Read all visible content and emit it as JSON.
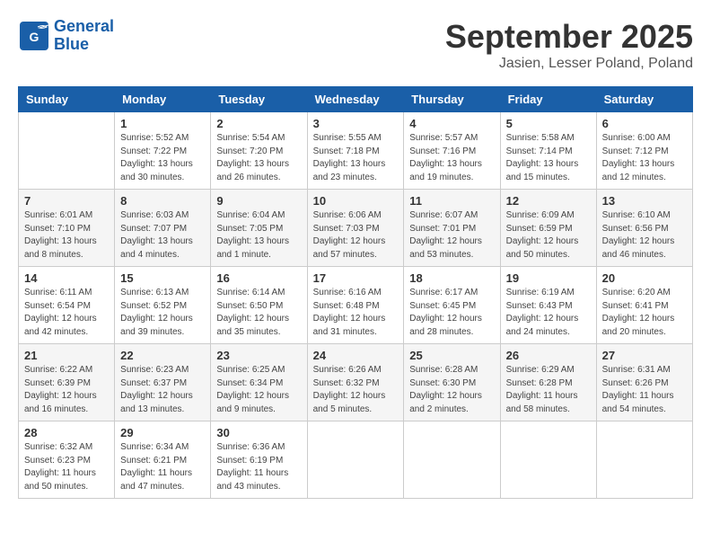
{
  "header": {
    "logo_line1": "General",
    "logo_line2": "Blue",
    "main_title": "September 2025",
    "subtitle": "Jasien, Lesser Poland, Poland"
  },
  "weekdays": [
    "Sunday",
    "Monday",
    "Tuesday",
    "Wednesday",
    "Thursday",
    "Friday",
    "Saturday"
  ],
  "weeks": [
    [
      {
        "day": "",
        "sunrise": "",
        "sunset": "",
        "daylight": ""
      },
      {
        "day": "1",
        "sunrise": "Sunrise: 5:52 AM",
        "sunset": "Sunset: 7:22 PM",
        "daylight": "Daylight: 13 hours and 30 minutes."
      },
      {
        "day": "2",
        "sunrise": "Sunrise: 5:54 AM",
        "sunset": "Sunset: 7:20 PM",
        "daylight": "Daylight: 13 hours and 26 minutes."
      },
      {
        "day": "3",
        "sunrise": "Sunrise: 5:55 AM",
        "sunset": "Sunset: 7:18 PM",
        "daylight": "Daylight: 13 hours and 23 minutes."
      },
      {
        "day": "4",
        "sunrise": "Sunrise: 5:57 AM",
        "sunset": "Sunset: 7:16 PM",
        "daylight": "Daylight: 13 hours and 19 minutes."
      },
      {
        "day": "5",
        "sunrise": "Sunrise: 5:58 AM",
        "sunset": "Sunset: 7:14 PM",
        "daylight": "Daylight: 13 hours and 15 minutes."
      },
      {
        "day": "6",
        "sunrise": "Sunrise: 6:00 AM",
        "sunset": "Sunset: 7:12 PM",
        "daylight": "Daylight: 13 hours and 12 minutes."
      }
    ],
    [
      {
        "day": "7",
        "sunrise": "Sunrise: 6:01 AM",
        "sunset": "Sunset: 7:10 PM",
        "daylight": "Daylight: 13 hours and 8 minutes."
      },
      {
        "day": "8",
        "sunrise": "Sunrise: 6:03 AM",
        "sunset": "Sunset: 7:07 PM",
        "daylight": "Daylight: 13 hours and 4 minutes."
      },
      {
        "day": "9",
        "sunrise": "Sunrise: 6:04 AM",
        "sunset": "Sunset: 7:05 PM",
        "daylight": "Daylight: 13 hours and 1 minute."
      },
      {
        "day": "10",
        "sunrise": "Sunrise: 6:06 AM",
        "sunset": "Sunset: 7:03 PM",
        "daylight": "Daylight: 12 hours and 57 minutes."
      },
      {
        "day": "11",
        "sunrise": "Sunrise: 6:07 AM",
        "sunset": "Sunset: 7:01 PM",
        "daylight": "Daylight: 12 hours and 53 minutes."
      },
      {
        "day": "12",
        "sunrise": "Sunrise: 6:09 AM",
        "sunset": "Sunset: 6:59 PM",
        "daylight": "Daylight: 12 hours and 50 minutes."
      },
      {
        "day": "13",
        "sunrise": "Sunrise: 6:10 AM",
        "sunset": "Sunset: 6:56 PM",
        "daylight": "Daylight: 12 hours and 46 minutes."
      }
    ],
    [
      {
        "day": "14",
        "sunrise": "Sunrise: 6:11 AM",
        "sunset": "Sunset: 6:54 PM",
        "daylight": "Daylight: 12 hours and 42 minutes."
      },
      {
        "day": "15",
        "sunrise": "Sunrise: 6:13 AM",
        "sunset": "Sunset: 6:52 PM",
        "daylight": "Daylight: 12 hours and 39 minutes."
      },
      {
        "day": "16",
        "sunrise": "Sunrise: 6:14 AM",
        "sunset": "Sunset: 6:50 PM",
        "daylight": "Daylight: 12 hours and 35 minutes."
      },
      {
        "day": "17",
        "sunrise": "Sunrise: 6:16 AM",
        "sunset": "Sunset: 6:48 PM",
        "daylight": "Daylight: 12 hours and 31 minutes."
      },
      {
        "day": "18",
        "sunrise": "Sunrise: 6:17 AM",
        "sunset": "Sunset: 6:45 PM",
        "daylight": "Daylight: 12 hours and 28 minutes."
      },
      {
        "day": "19",
        "sunrise": "Sunrise: 6:19 AM",
        "sunset": "Sunset: 6:43 PM",
        "daylight": "Daylight: 12 hours and 24 minutes."
      },
      {
        "day": "20",
        "sunrise": "Sunrise: 6:20 AM",
        "sunset": "Sunset: 6:41 PM",
        "daylight": "Daylight: 12 hours and 20 minutes."
      }
    ],
    [
      {
        "day": "21",
        "sunrise": "Sunrise: 6:22 AM",
        "sunset": "Sunset: 6:39 PM",
        "daylight": "Daylight: 12 hours and 16 minutes."
      },
      {
        "day": "22",
        "sunrise": "Sunrise: 6:23 AM",
        "sunset": "Sunset: 6:37 PM",
        "daylight": "Daylight: 12 hours and 13 minutes."
      },
      {
        "day": "23",
        "sunrise": "Sunrise: 6:25 AM",
        "sunset": "Sunset: 6:34 PM",
        "daylight": "Daylight: 12 hours and 9 minutes."
      },
      {
        "day": "24",
        "sunrise": "Sunrise: 6:26 AM",
        "sunset": "Sunset: 6:32 PM",
        "daylight": "Daylight: 12 hours and 5 minutes."
      },
      {
        "day": "25",
        "sunrise": "Sunrise: 6:28 AM",
        "sunset": "Sunset: 6:30 PM",
        "daylight": "Daylight: 12 hours and 2 minutes."
      },
      {
        "day": "26",
        "sunrise": "Sunrise: 6:29 AM",
        "sunset": "Sunset: 6:28 PM",
        "daylight": "Daylight: 11 hours and 58 minutes."
      },
      {
        "day": "27",
        "sunrise": "Sunrise: 6:31 AM",
        "sunset": "Sunset: 6:26 PM",
        "daylight": "Daylight: 11 hours and 54 minutes."
      }
    ],
    [
      {
        "day": "28",
        "sunrise": "Sunrise: 6:32 AM",
        "sunset": "Sunset: 6:23 PM",
        "daylight": "Daylight: 11 hours and 50 minutes."
      },
      {
        "day": "29",
        "sunrise": "Sunrise: 6:34 AM",
        "sunset": "Sunset: 6:21 PM",
        "daylight": "Daylight: 11 hours and 47 minutes."
      },
      {
        "day": "30",
        "sunrise": "Sunrise: 6:36 AM",
        "sunset": "Sunset: 6:19 PM",
        "daylight": "Daylight: 11 hours and 43 minutes."
      },
      {
        "day": "",
        "sunrise": "",
        "sunset": "",
        "daylight": ""
      },
      {
        "day": "",
        "sunrise": "",
        "sunset": "",
        "daylight": ""
      },
      {
        "day": "",
        "sunrise": "",
        "sunset": "",
        "daylight": ""
      },
      {
        "day": "",
        "sunrise": "",
        "sunset": "",
        "daylight": ""
      }
    ]
  ]
}
